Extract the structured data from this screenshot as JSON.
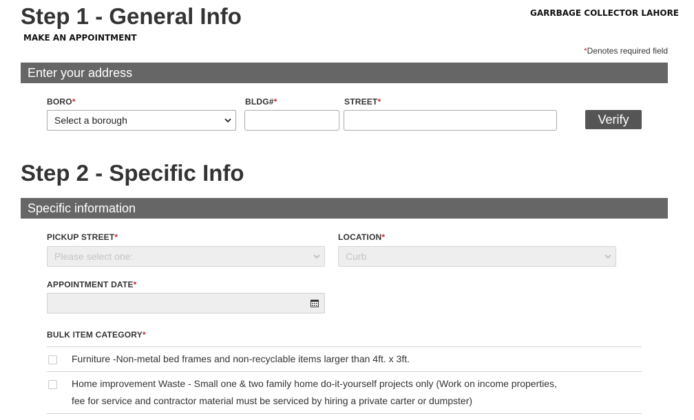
{
  "step1": {
    "title": "Step 1 - General Info",
    "subtitle": "MAKE AN APPOINTMENT"
  },
  "brand": "GARRBAGE COLLECTOR LAHORE",
  "required_note": {
    "star": "*",
    "text": "Denotes required field"
  },
  "address_section": {
    "header": "Enter your address",
    "boro": {
      "label": "BORO",
      "value": "Select a borough"
    },
    "bldg": {
      "label": "BLDG#",
      "value": ""
    },
    "street": {
      "label": "STREET",
      "value": ""
    },
    "verify_label": "Verify"
  },
  "step2": {
    "title": "Step 2 - Specific Info"
  },
  "specific_section": {
    "header": "Specific information",
    "pickup_street": {
      "label": "PICKUP STREET",
      "value": "Please select one:"
    },
    "location": {
      "label": "LOCATION",
      "value": "Curb"
    },
    "appointment_date": {
      "label": "APPOINTMENT DATE",
      "value": ""
    },
    "bulk_category": {
      "label": "BULK ITEM CATEGORY",
      "items": [
        {
          "line1": "Furniture -Non-metal bed frames and non-recyclable items larger than 4ft. x 3ft.",
          "line2": "",
          "checked": false
        },
        {
          "line1": "Home improvement Waste - Small one & two family home do-it-yourself projects only (Work on income properties,",
          "line2": "fee for service and contractor material must be serviced by hiring a private carter or dumpster)",
          "checked": false
        }
      ]
    }
  },
  "star": "*",
  "colors": {
    "section_bar": "#666666",
    "verify_button": "#555555",
    "required_star": "#c0282d",
    "title_text": "#333333"
  },
  "icons": {
    "select_chevron": "chevron-down-icon",
    "calendar": "calendar-icon"
  }
}
